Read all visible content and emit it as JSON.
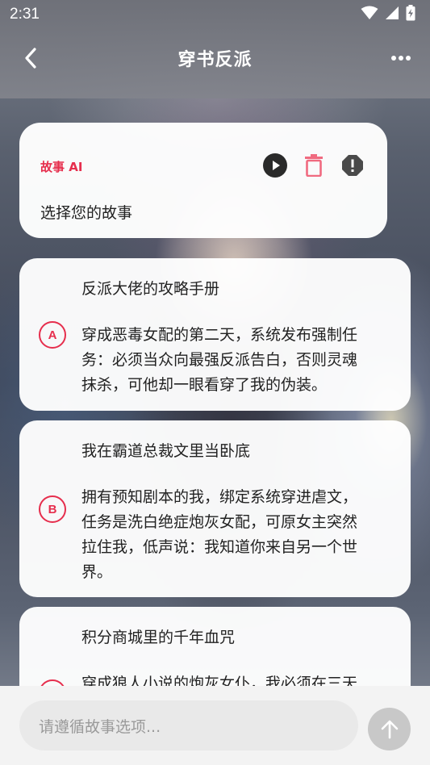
{
  "status_bar": {
    "time": "2:31",
    "icons": [
      "wifi-icon",
      "cellular-icon",
      "battery-charging-icon"
    ]
  },
  "header": {
    "title": "穿书反派",
    "back_icon": "chevron-left-icon",
    "more_icon": "more-horizontal-icon"
  },
  "ai_message": {
    "sender": "故事 AI",
    "text": "选择您的故事",
    "actions": [
      "play-icon",
      "delete-icon",
      "report-icon"
    ]
  },
  "options": [
    {
      "badge": "A",
      "title": "反派大佬的攻略手册",
      "lines": [
        "穿成恶毒女配的第二天，系统发布强制任",
        "务：必须当众向最强反派告白，否则灵魂",
        "抹杀，可他却一眼看穿了我的伪装。"
      ]
    },
    {
      "badge": "B",
      "title": "我在霸道总裁文里当卧底",
      "lines": [
        "拥有预知剧本的我，绑定系统穿进虐文，",
        "任务是洗白绝症炮灰女配，可原女主突然",
        "拉住我，低声说：我知道你来自另一个世",
        "界。"
      ]
    },
    {
      "badge": "C",
      "title": "积分商城里的千年血咒",
      "lines": [
        "穿成狼人小说的炮灰女仆，我必须在三天"
      ]
    }
  ],
  "input": {
    "placeholder": "请遵循故事选项..."
  },
  "colors": {
    "accent": "#e62e4d",
    "send_button": "#c8c8c8"
  }
}
